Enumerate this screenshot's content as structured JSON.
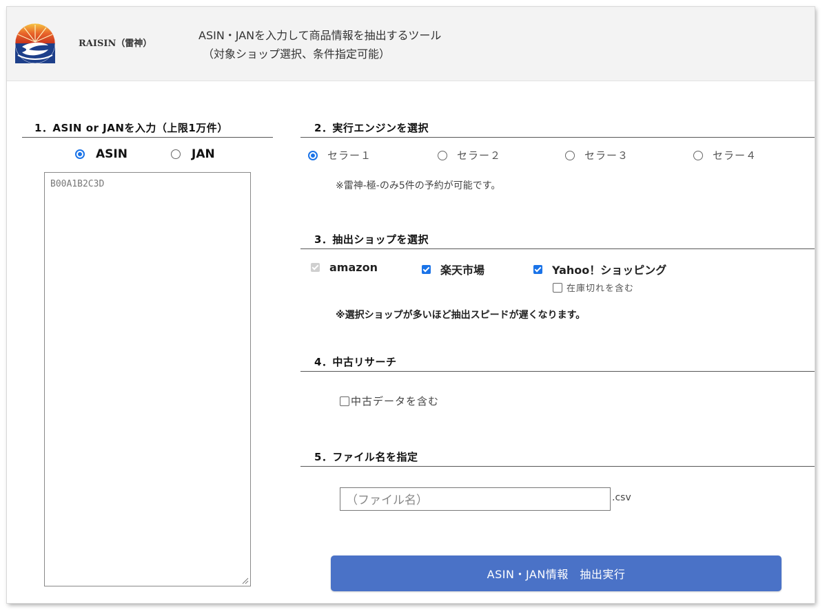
{
  "header": {
    "brand": "RAISIN（雷神）",
    "tagline_line1": "ASIN・JANを入力して商品情報を抽出するツール",
    "tagline_line2": "（対象ショップ選択、条件指定可能）"
  },
  "section1": {
    "title": "1．ASIN or JANを入力（上限1万件）",
    "options": [
      {
        "label": "ASIN",
        "selected": true
      },
      {
        "label": "JAN",
        "selected": false
      }
    ],
    "textarea_value": "B00A1B2C3D"
  },
  "section2": {
    "title": "2．実行エンジンを選択",
    "options": [
      {
        "label": "セラー１",
        "selected": true
      },
      {
        "label": "セラー２",
        "selected": false
      },
      {
        "label": "セラー３",
        "selected": false
      },
      {
        "label": "セラー４",
        "selected": false
      }
    ],
    "note": "※雷神-極-のみ5件の予約が可能です。"
  },
  "section3": {
    "title": "3．抽出ショップを選択",
    "shops": [
      {
        "label": "amazon",
        "checked": true,
        "disabled": true
      },
      {
        "label": "楽天市場",
        "checked": true,
        "disabled": false
      },
      {
        "label": "Yahoo！ショッピング",
        "checked": true,
        "disabled": false
      }
    ],
    "sub_option": {
      "label": "在庫切れを含む",
      "checked": false
    },
    "note": "※選択ショップが多いほど抽出スピードが遅くなります。"
  },
  "section4": {
    "title": "4．中古リサーチ",
    "option": {
      "label": "中古データを含む",
      "checked": false
    }
  },
  "section5": {
    "title": "5．ファイル名を指定",
    "placeholder": "（ファイル名）",
    "extension": ".csv"
  },
  "submit": {
    "label": "ASIN・JAN情報　抽出実行"
  },
  "colors": {
    "accent": "#1a73e8",
    "button": "#4a72c7",
    "header_bg": "#f3f3f3"
  }
}
